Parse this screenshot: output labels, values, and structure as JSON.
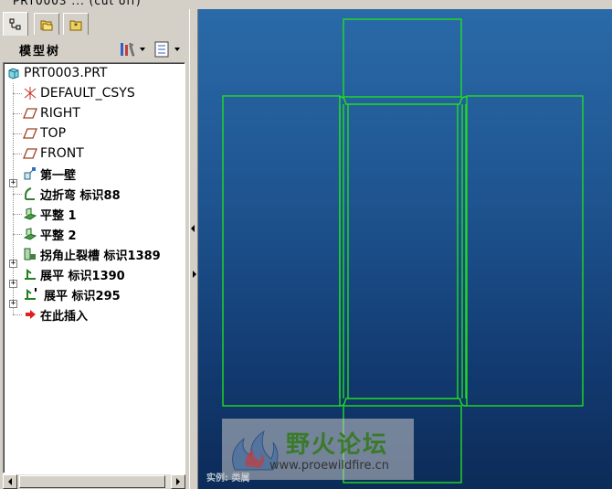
{
  "window": {
    "title": "PRT0003 ... (cut off)"
  },
  "tabs": [
    {
      "name": "model-tree",
      "icon": "tree-icon",
      "active": true
    },
    {
      "name": "folders",
      "icon": "folder-icon",
      "active": false
    },
    {
      "name": "favorites",
      "icon": "favorites-folder-icon",
      "active": false
    }
  ],
  "tree_panel": {
    "title": "模型树",
    "settings_icon": "tools-icon",
    "show_icon": "list-icon"
  },
  "tree": {
    "root": "PRT0003.PRT",
    "items": [
      {
        "label": "DEFAULT_CSYS",
        "icon": "csys-icon",
        "expandable": false
      },
      {
        "label": "RIGHT",
        "icon": "datum-plane-icon",
        "expandable": false
      },
      {
        "label": "TOP",
        "icon": "datum-plane-icon",
        "expandable": false
      },
      {
        "label": "FRONT",
        "icon": "datum-plane-icon",
        "expandable": false
      },
      {
        "label": "第一壁",
        "icon": "first-wall-icon",
        "expandable": true
      },
      {
        "label": "边折弯 标识88",
        "icon": "edge-bend-icon",
        "expandable": false
      },
      {
        "label": "平整 1",
        "icon": "flat-wall-icon",
        "expandable": false
      },
      {
        "label": "平整 2",
        "icon": "flat-wall-icon",
        "expandable": false
      },
      {
        "label": "拐角止裂槽 标识1389",
        "icon": "corner-relief-icon",
        "expandable": true
      },
      {
        "label": "展平 标识1390",
        "icon": "unbend-icon",
        "expandable": true
      },
      {
        "label": "展平 标识295",
        "icon": "unbend-icon",
        "expandable": true
      },
      {
        "label": "在此插入",
        "icon": "insert-here-arrow-icon",
        "expandable": false
      }
    ]
  },
  "viewport": {
    "material_label": "实例: 类属",
    "outline_color": "#22dd22"
  },
  "watermark": {
    "title": "野火论坛",
    "url": "www.proewildfire.cn"
  }
}
